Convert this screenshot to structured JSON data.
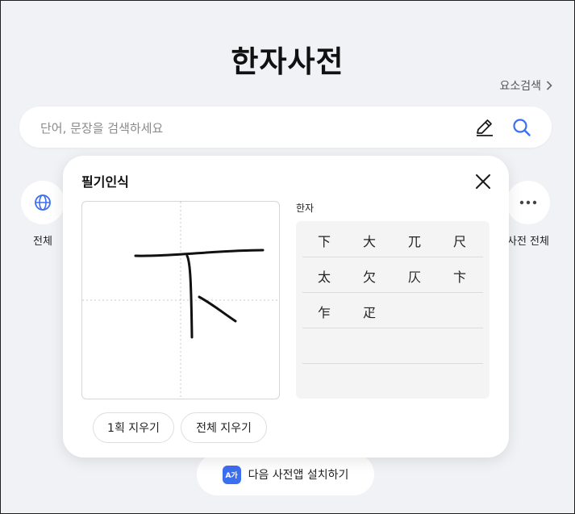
{
  "page": {
    "title": "한자사전",
    "element_search_label": "요소검색"
  },
  "search": {
    "placeholder": "단어, 문장을 검색하세요",
    "value": ""
  },
  "categories": {
    "left_label": "전체",
    "right_label": "사전 전체"
  },
  "install": {
    "icon_text": "A가",
    "label": "다음 사전앱 설치하기"
  },
  "handwriting": {
    "title": "필기인식",
    "results_label": "한자",
    "results": [
      [
        "下",
        "大",
        "兀",
        "尺"
      ],
      [
        "太",
        "欠",
        "仄",
        "卞"
      ],
      [
        "乍",
        "疋"
      ],
      [],
      []
    ],
    "erase_stroke_label": "1획 지우기",
    "erase_all_label": "전체 지우기"
  },
  "colors": {
    "accent": "#3c6ef0",
    "background": "#f1f2f6"
  },
  "icons": {
    "handwrite": "pen-icon",
    "search": "search-icon",
    "globe": "globe-icon",
    "more": "more-dots-icon",
    "close": "close-icon",
    "chevron": "chevron-right-icon"
  }
}
